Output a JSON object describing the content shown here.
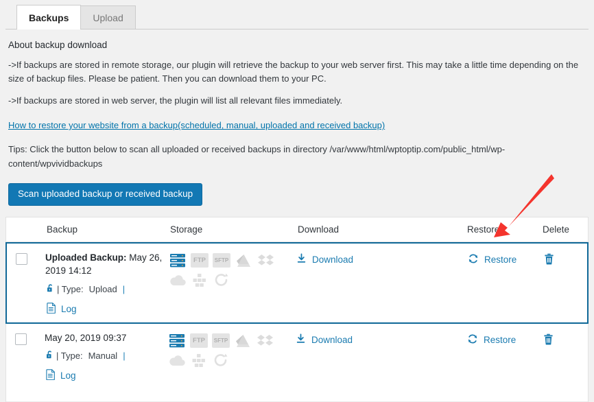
{
  "tabs": [
    {
      "label": "Backups",
      "active": true
    },
    {
      "label": "Upload",
      "active": false
    }
  ],
  "about": {
    "heading": "About backup download",
    "para1": "->If backups are stored in remote storage, our plugin will retrieve the backup to your web server first. This may take a little time depending on the size of backup files. Please be patient. Then you can download them to your PC.",
    "para2": "->If backups are stored in web server, the plugin will list all relevant files immediately.",
    "restore_link": "How to restore your website from a backup(scheduled, manual, uploaded and received backup)",
    "tips": "Tips: Click the button below to scan all uploaded or received backups in directory /var/www/html/wptoptip.com/public_html/wp-content/wpvividbackups",
    "scan_button": "Scan uploaded backup or received backup"
  },
  "table": {
    "headers": {
      "backup": "Backup",
      "storage": "Storage",
      "download": "Download",
      "restore": "Restore",
      "delete": "Delete"
    },
    "rows": [
      {
        "selected": true,
        "title_prefix": "Uploaded Backup:",
        "title_date": "May 26, 2019 14:12",
        "lock_icon": "unlock-icon",
        "type_label": "| Type:",
        "type_value": "Upload",
        "type_suffix": "|",
        "log_label": "Log",
        "storage_icons": [
          {
            "name": "server-icon",
            "active": true
          },
          {
            "name": "ftp-icon",
            "active": false,
            "text": "FTP"
          },
          {
            "name": "sftp-icon",
            "active": false,
            "text": "SFTP"
          },
          {
            "name": "google-drive-icon",
            "active": false
          },
          {
            "name": "dropbox-icon",
            "active": false
          },
          {
            "name": "onedrive-icon",
            "active": false
          },
          {
            "name": "amazon-s3-icon",
            "active": false
          },
          {
            "name": "pcloud-icon",
            "active": false
          }
        ],
        "download_label": "Download",
        "restore_label": "Restore",
        "delete_icon": "trash-icon"
      },
      {
        "selected": false,
        "title_prefix": "",
        "title_date": "May 20, 2019 09:37",
        "lock_icon": "unlock-icon",
        "type_label": "| Type:",
        "type_value": "Manual",
        "type_suffix": "|",
        "log_label": "Log",
        "storage_icons": [
          {
            "name": "server-icon",
            "active": true
          },
          {
            "name": "ftp-icon",
            "active": false,
            "text": "FTP"
          },
          {
            "name": "sftp-icon",
            "active": false,
            "text": "SFTP"
          },
          {
            "name": "google-drive-icon",
            "active": false
          },
          {
            "name": "dropbox-icon",
            "active": false
          },
          {
            "name": "onedrive-icon",
            "active": false
          },
          {
            "name": "amazon-s3-icon",
            "active": false
          },
          {
            "name": "pcloud-icon",
            "active": false
          }
        ],
        "download_label": "Download",
        "restore_label": "Restore",
        "delete_icon": "trash-icon"
      }
    ]
  },
  "annotation": {
    "arrow_color": "#f4342d",
    "points_to": "restore-link-row-1"
  },
  "colors": {
    "accent": "#1a7bb0",
    "button": "#1278b4",
    "page_bg": "#f1f1f1",
    "selected_border": "#0f6897"
  }
}
